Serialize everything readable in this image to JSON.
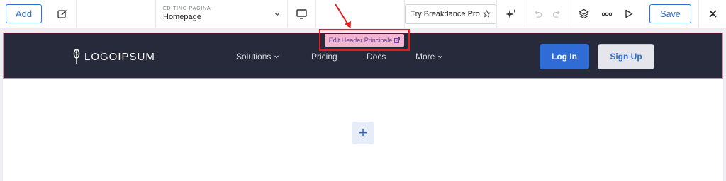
{
  "toolbar": {
    "add_label": "Add",
    "editing_label": "EDITING PAGINA",
    "page_name": "Homepage",
    "pro_label": "Try Breakdance Pro",
    "save_label": "Save"
  },
  "header": {
    "logo_text": "LOGOIPSUM",
    "nav": [
      "Solutions",
      "Pricing",
      "Docs",
      "More"
    ],
    "login_label": "Log In",
    "signup_label": "Sign Up"
  },
  "tooltip": {
    "edit_label": "Edit Header Principale"
  },
  "icons": {
    "edit": "pencil-square-icon",
    "device": "monitor-icon",
    "ai": "sparkle-icon",
    "undo": "undo-icon",
    "redo": "redo-icon",
    "layers": "layers-icon",
    "more": "more-dots-icon",
    "preview": "play-icon",
    "close": "close-icon"
  },
  "colors": {
    "accent": "#2f6cd6",
    "header_bg": "#272a3a",
    "annotation": "#e11d1d",
    "tooltip_bg": "#f3b6d0"
  }
}
